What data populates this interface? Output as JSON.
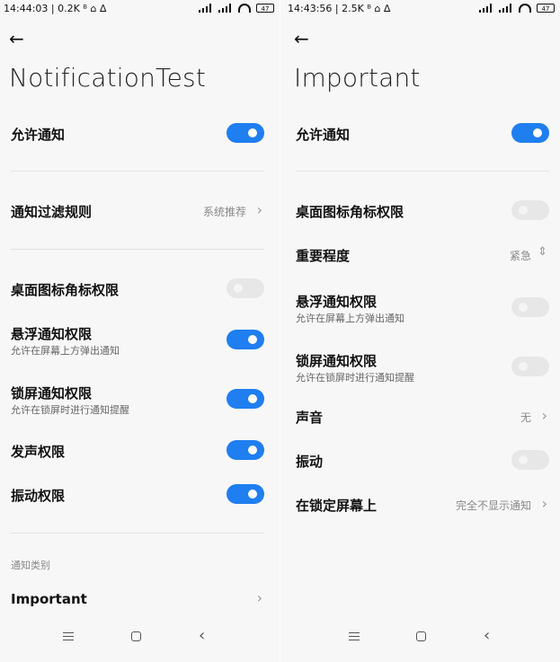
{
  "left": {
    "status_text": "14:44:03 | 0.2K ᴮ ⌂ ∆",
    "battery": "47",
    "title": "NotificationTest",
    "allow_notifications": {
      "label": "允许通知",
      "on": true
    },
    "filter_rule": {
      "label": "通知过滤规则",
      "value": "系统推荐"
    },
    "rows": [
      {
        "label": "桌面图标角标权限",
        "sub": "",
        "on": false
      },
      {
        "label": "悬浮通知权限",
        "sub": "允许在屏幕上方弹出通知",
        "on": true
      },
      {
        "label": "锁屏通知权限",
        "sub": "允许在锁屏时进行通知提醒",
        "on": true
      },
      {
        "label": "发声权限",
        "sub": "",
        "on": true
      },
      {
        "label": "振动权限",
        "sub": "",
        "on": true
      }
    ],
    "section_title": "通知类别",
    "category": "Important"
  },
  "right": {
    "status_text": "14:43:56 | 2.5K ᴮ ⌂ ∆",
    "battery": "47",
    "title": "Important",
    "allow_notifications": {
      "label": "允许通知",
      "on": true
    },
    "badge": {
      "label": "桌面图标角标权限",
      "on": false
    },
    "importance": {
      "label": "重要程度",
      "value": "紧急"
    },
    "floating": {
      "label": "悬浮通知权限",
      "sub": "允许在屏幕上方弹出通知",
      "on": false
    },
    "lockscreen": {
      "label": "锁屏通知权限",
      "sub": "允许在锁屏时进行通知提醒",
      "on": false
    },
    "sound": {
      "label": "声音",
      "value": "无"
    },
    "vibration": {
      "label": "振动",
      "on": false
    },
    "lock_display": {
      "label": "在锁定屏幕上",
      "value": "完全不显示通知"
    }
  },
  "colors": {
    "accent": "#1f7ef0",
    "toggle_off": "#e7e7e7",
    "background": "#f7f7f7"
  },
  "icons": {
    "back": "back-arrow-icon",
    "chevron": "chevron-right-icon",
    "updown": "chevron-updown-icon"
  }
}
